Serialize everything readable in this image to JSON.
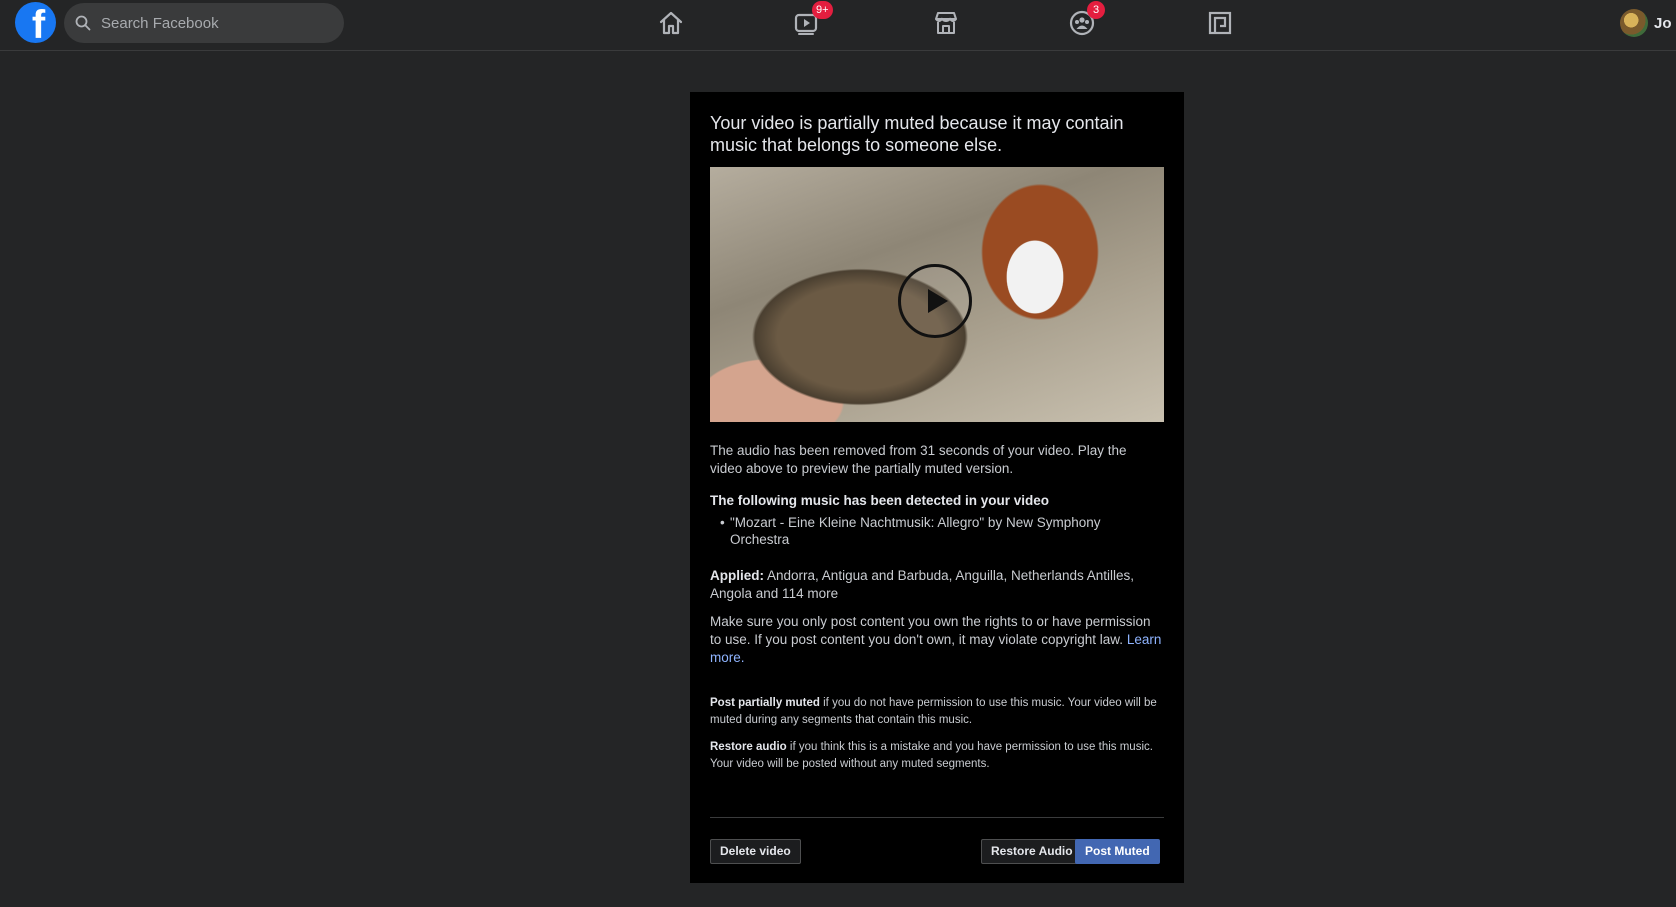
{
  "topbar": {
    "logo_letter": "f",
    "search_placeholder": "Search Facebook",
    "nav": [
      {
        "icon": "home-icon"
      },
      {
        "icon": "watch-icon",
        "badge": "9+"
      },
      {
        "icon": "marketplace-icon"
      },
      {
        "icon": "groups-icon",
        "badge": "3"
      },
      {
        "icon": "gaming-icon"
      }
    ],
    "profile_name": "Jo"
  },
  "dialog": {
    "title": "Your video is partially muted because it may contain music that belongs to someone else.",
    "audio_removed": "The audio has been removed from 31 seconds of your video. Play the video above to preview the partially muted version.",
    "detected_heading": "The following music has been detected in your video",
    "tracks": [
      "\"Mozart - Eine Kleine Nachtmusik: Allegro\" by New Symphony Orchestra"
    ],
    "applied_label": "Applied:",
    "applied_text": "Andorra, Antigua and Barbuda, Anguilla, Netherlands Antilles, Angola and 114 more",
    "rights_text": "Make sure you only post content you own the rights to or have permission to use. If you post content you don't own, it may violate copyright law.",
    "learn_more": "Learn more.",
    "post_partial_label": "Post partially muted",
    "post_partial_text": "if you do not have permission to use this music. Your video will be muted during any segments that contain this music.",
    "restore_label": "Restore audio",
    "restore_text": "if you think this is a mistake and you have permission to use this music. Your video will be posted without any muted segments.",
    "buttons": {
      "delete": "Delete video",
      "restore": "Restore Audio",
      "post": "Post Muted"
    }
  },
  "colors": {
    "background": "#242526",
    "dialog": "#000000",
    "primary_button": "#4267b2",
    "badge": "#e41e3f",
    "link": "#8fb4ff"
  }
}
